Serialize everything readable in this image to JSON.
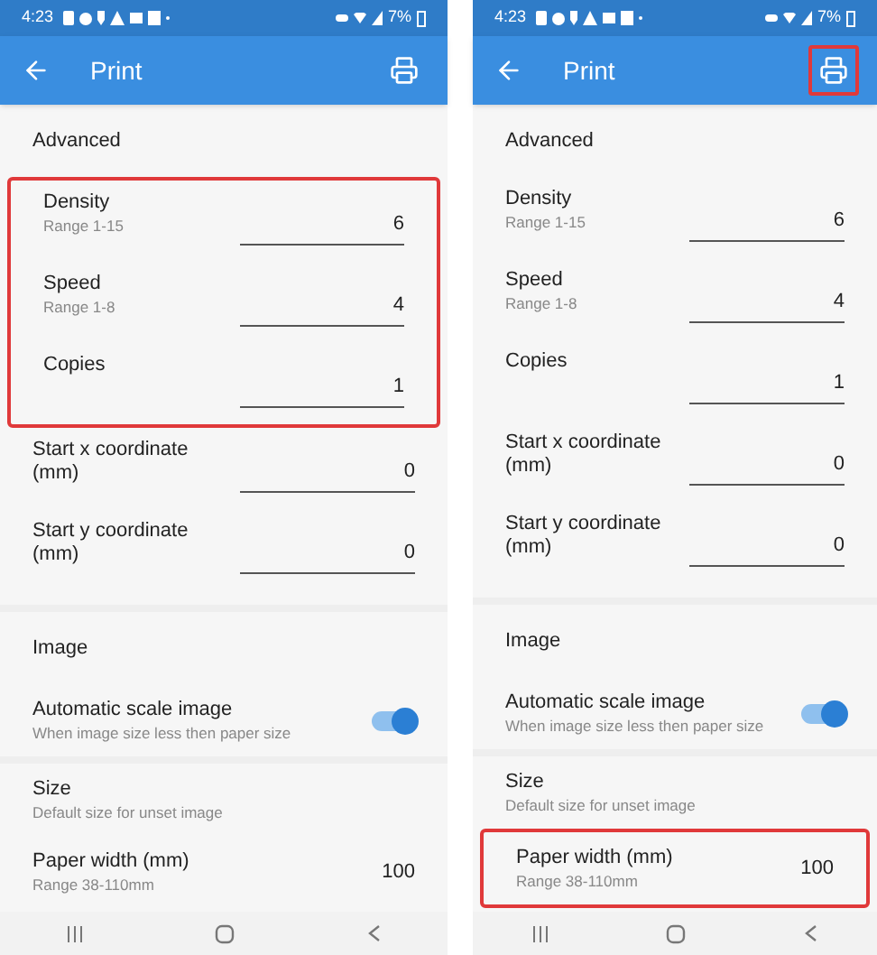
{
  "phones": [
    {
      "status_time": "4:23",
      "battery": "7%",
      "title": "Print",
      "print_highlighted": false,
      "sections": [
        {
          "rows": [
            {
              "kind": "heading",
              "label": "Advanced",
              "highlighted": false
            },
            {
              "kind": "field",
              "label": "Density",
              "sublabel": "Range 1-15",
              "value": "6",
              "highlighted": true
            },
            {
              "kind": "field",
              "label": "Speed",
              "sublabel": "Range 1-8",
              "value": "4",
              "highlighted": true
            },
            {
              "kind": "field",
              "label": "Copies",
              "value": "1",
              "highlighted": true
            },
            {
              "kind": "field",
              "label": "Start x coordinate (mm)",
              "value": "0",
              "highlighted": false
            },
            {
              "kind": "field",
              "label": "Start y coordinate (mm)",
              "value": "0",
              "highlighted": false
            }
          ]
        },
        {
          "rows": [
            {
              "kind": "heading",
              "label": "Image",
              "highlighted": false
            },
            {
              "kind": "switch",
              "label": "Automatic scale image",
              "sublabel": "When image size less then paper size",
              "on": true,
              "highlighted": false
            }
          ]
        },
        {
          "rows": [
            {
              "kind": "heading",
              "label": "Size",
              "sublabel": "Default size for unset image",
              "highlighted": false
            },
            {
              "kind": "value",
              "label": "Paper width (mm)",
              "sublabel": "Range 38-110mm",
              "value": "100",
              "highlighted": false
            }
          ]
        }
      ]
    },
    {
      "status_time": "4:23",
      "battery": "7%",
      "title": "Print",
      "print_highlighted": true,
      "sections": [
        {
          "rows": [
            {
              "kind": "heading",
              "label": "Advanced",
              "highlighted": false
            },
            {
              "kind": "field",
              "label": "Density",
              "sublabel": "Range 1-15",
              "value": "6",
              "highlighted": false
            },
            {
              "kind": "field",
              "label": "Speed",
              "sublabel": "Range 1-8",
              "value": "4",
              "highlighted": false
            },
            {
              "kind": "field",
              "label": "Copies",
              "value": "1",
              "highlighted": false
            },
            {
              "kind": "field",
              "label": "Start x coordinate (mm)",
              "value": "0",
              "highlighted": false
            },
            {
              "kind": "field",
              "label": "Start y coordinate (mm)",
              "value": "0",
              "highlighted": false
            }
          ]
        },
        {
          "rows": [
            {
              "kind": "heading",
              "label": "Image",
              "highlighted": false
            },
            {
              "kind": "switch",
              "label": "Automatic scale image",
              "sublabel": "When image size less then paper size",
              "on": true,
              "highlighted": false
            }
          ]
        },
        {
          "rows": [
            {
              "kind": "heading",
              "label": "Size",
              "sublabel": "Default size for unset image",
              "highlighted": false
            },
            {
              "kind": "value",
              "label": "Paper width (mm)",
              "sublabel": "Range 38-110mm",
              "value": "100",
              "highlighted": true
            }
          ]
        }
      ]
    }
  ]
}
